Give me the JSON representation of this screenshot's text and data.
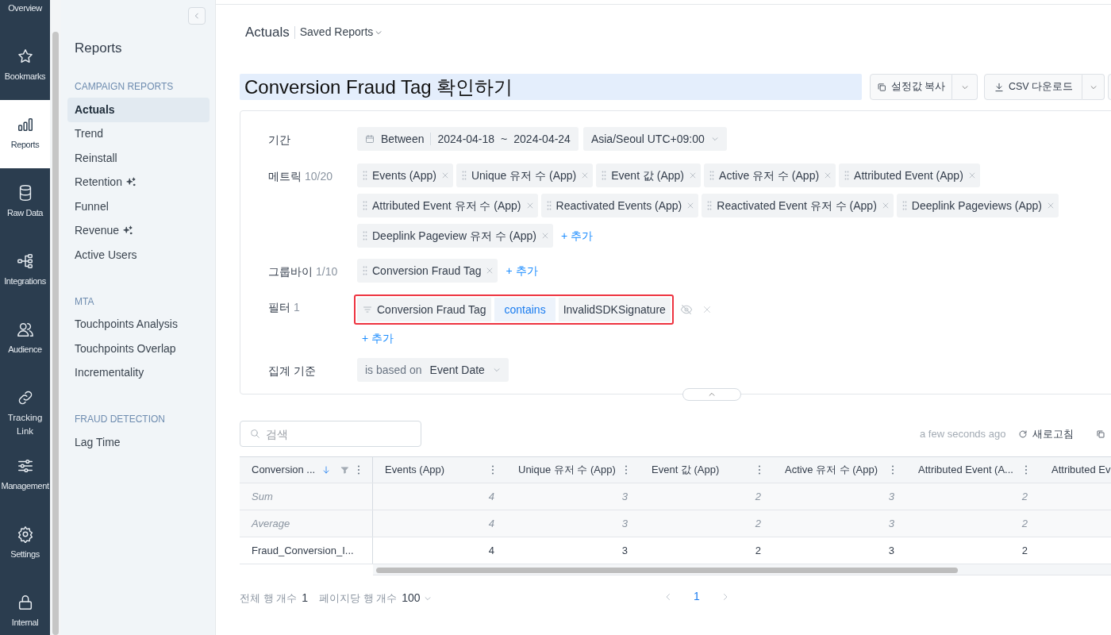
{
  "rail": [
    {
      "label": "Overview",
      "selected": false
    },
    {
      "label": "Bookmarks",
      "selected": false
    },
    {
      "label": "Reports",
      "selected": true
    },
    {
      "label": "Raw Data",
      "selected": false
    },
    {
      "label": "Integrations",
      "selected": false
    },
    {
      "label": "Audience",
      "selected": false
    },
    {
      "label": "Tracking Link",
      "selected": false
    },
    {
      "label": "Management",
      "selected": false
    },
    {
      "label": "Settings",
      "selected": false
    },
    {
      "label": "Internal",
      "selected": false
    }
  ],
  "sidebar": {
    "title": "Reports",
    "sections": [
      {
        "title": "CAMPAIGN REPORTS",
        "items": [
          {
            "label": "Actuals",
            "selected": true,
            "sparkle": false
          },
          {
            "label": "Trend",
            "selected": false,
            "sparkle": false
          },
          {
            "label": "Reinstall",
            "selected": false,
            "sparkle": false
          },
          {
            "label": "Retention",
            "selected": false,
            "sparkle": true
          },
          {
            "label": "Funnel",
            "selected": false,
            "sparkle": false
          },
          {
            "label": "Revenue",
            "selected": false,
            "sparkle": true
          },
          {
            "label": "Active Users",
            "selected": false,
            "sparkle": false
          }
        ]
      },
      {
        "title": "MTA",
        "items": [
          {
            "label": "Touchpoints Analysis",
            "selected": false,
            "sparkle": false
          },
          {
            "label": "Touchpoints Overlap",
            "selected": false,
            "sparkle": false
          },
          {
            "label": "Incrementality",
            "selected": false,
            "sparkle": false
          }
        ]
      },
      {
        "title": "FRAUD DETECTION",
        "items": [
          {
            "label": "Lag Time",
            "selected": false,
            "sparkle": false
          }
        ]
      }
    ]
  },
  "breadcrumb": {
    "page": "Actuals",
    "saved": "Saved Reports"
  },
  "report_title": "Conversion Fraud Tag 확인하기",
  "actions": [
    {
      "label": "설정값 복사",
      "kind": "copy"
    },
    {
      "label": "CSV 다운로드",
      "kind": "download"
    }
  ],
  "settings": {
    "period": {
      "label": "기간",
      "mode": "Between",
      "start": "2024-04-18",
      "sep": "~",
      "end": "2024-04-24",
      "timezone": "Asia/Seoul UTC+09:00"
    },
    "metrics": {
      "label": "메트릭",
      "count": "10/20",
      "chips": [
        "Events (App)",
        "Unique 유저 수 (App)",
        "Event 값 (App)",
        "Active 유저 수 (App)",
        "Attributed Event (App)",
        "Attributed Event 유저 수 (App)",
        "Reactivated Events (App)",
        "Reactivated Event 유저 수 (App)",
        "Deeplink Pageviews (App)",
        "Deeplink Pageview 유저 수 (App)"
      ],
      "add": "+ 추가"
    },
    "groupby": {
      "label": "그룹바이",
      "count": "1/10",
      "chips": [
        "Conversion Fraud Tag"
      ],
      "add": "+ 추가"
    },
    "filter": {
      "label": "필터",
      "count": "1",
      "field": "Conversion Fraud Tag",
      "operator": "contains",
      "value": "InvalidSDKSignature",
      "highlighted": true,
      "add": "+ 추가"
    },
    "aggregation": {
      "label": "집계 기준",
      "prefix": "is based on",
      "value": "Event Date"
    }
  },
  "toolbar": {
    "search_placeholder": "검색",
    "updated": "a few seconds ago",
    "refresh": "새로고침"
  },
  "table": {
    "key_column": {
      "label": "Conversion ...",
      "sorted": true,
      "filter": true
    },
    "columns": [
      "Events (App)",
      "Unique 유저 수 (App)",
      "Event 값 (App)",
      "Active 유저 수 (App)",
      "Attributed Event (A...",
      "Attributed Ev"
    ],
    "rows": [
      {
        "kind": "summary",
        "cells": [
          "Sum",
          "4",
          "3",
          "2",
          "3",
          "2"
        ]
      },
      {
        "kind": "summary",
        "cells": [
          "Average",
          "4",
          "3",
          "2",
          "3",
          "2"
        ]
      },
      {
        "kind": "data",
        "cells": [
          "Fraud_Conversion_I...",
          "4",
          "3",
          "2",
          "3",
          "2"
        ]
      }
    ]
  },
  "footer": {
    "total_label": "전체 행 개수",
    "total": "1",
    "per_page_label": "페이지당 행 개수",
    "per_page": "100",
    "pages": [
      {
        "label": "1",
        "selected": true
      }
    ]
  }
}
